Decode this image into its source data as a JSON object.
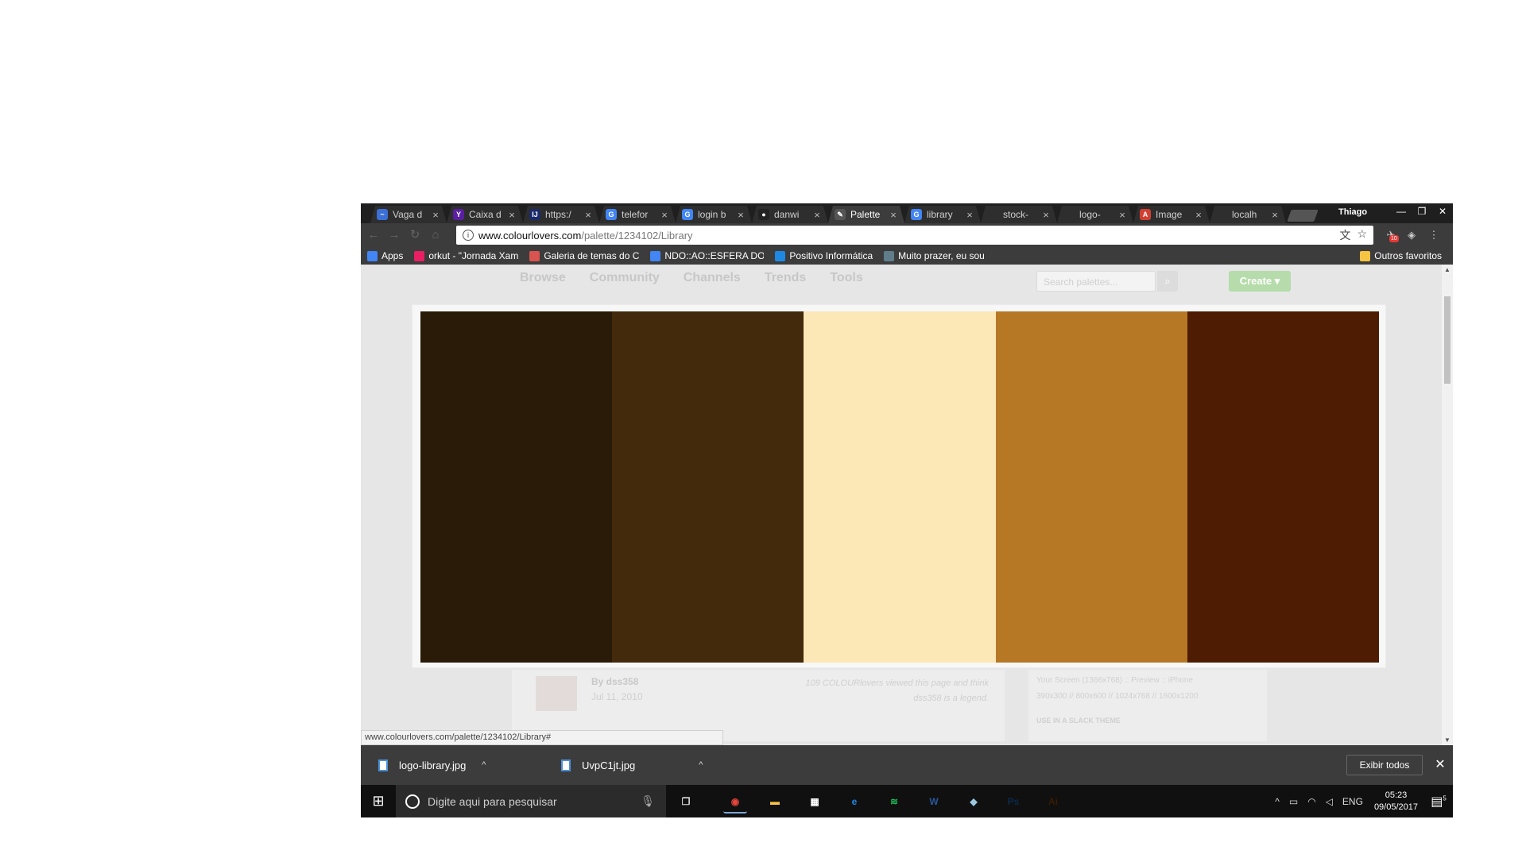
{
  "browser": {
    "tabs": [
      {
        "label": "Vaga d",
        "favicon_color": "#3b6fd6",
        "favicon_glyph": "~",
        "icon": "vaga-favicon-icon"
      },
      {
        "label": "Caixa d",
        "favicon_color": "#5a1fa0",
        "favicon_glyph": "Y",
        "icon": "yahoo-mail-icon"
      },
      {
        "label": "https:/",
        "favicon_color": "#1b2a6b",
        "favicon_glyph": "IJ",
        "icon": "intellij-icon"
      },
      {
        "label": "telefor",
        "favicon_color": "#4285f4",
        "favicon_glyph": "G",
        "icon": "google-icon"
      },
      {
        "label": "login b",
        "favicon_color": "#4285f4",
        "favicon_glyph": "G",
        "icon": "google-icon"
      },
      {
        "label": "danwi",
        "favicon_color": "#222222",
        "favicon_glyph": "●",
        "icon": "github-icon"
      },
      {
        "label": "Palette",
        "favicon_color": "#555555",
        "favicon_glyph": "✎",
        "icon": "colourlovers-icon",
        "active": true
      },
      {
        "label": "library",
        "favicon_color": "#4285f4",
        "favicon_glyph": "G",
        "icon": "google-icon"
      },
      {
        "label": "stock-",
        "favicon_color": "#2e2e2e",
        "favicon_glyph": "",
        "icon": "blank-page-icon"
      },
      {
        "label": "logo-",
        "favicon_color": "#2e2e2e",
        "favicon_glyph": "",
        "icon": "blank-page-icon"
      },
      {
        "label": "Image",
        "favicon_color": "#d23f31",
        "favicon_glyph": "A",
        "icon": "angular-icon"
      },
      {
        "label": "localh",
        "favicon_color": "#2e2e2e",
        "favicon_glyph": "",
        "icon": "blank-page-icon"
      }
    ],
    "profile_name": "Thiago",
    "window_controls": {
      "minimize": "—",
      "restore": "❐",
      "close": "✕"
    },
    "address": {
      "host": "www.colourlovers.com",
      "path": "/palette/1234102/Library"
    },
    "extension_badge": "10",
    "bookmarks": [
      {
        "label": "Apps",
        "color": "#4285f4"
      },
      {
        "label": "orkut - \"Jornada Xam",
        "color": "#e91e63"
      },
      {
        "label": "Galeria de temas do C",
        "color": "#d9534f"
      },
      {
        "label": "NDO::AO::ESFERA DO",
        "color": "#4285f4"
      },
      {
        "label": "Positivo Informática",
        "color": "#1e88e5"
      },
      {
        "label": "Muito prazer, eu sou",
        "color": "#607d8b"
      }
    ],
    "other_bookmarks": "Outros favoritos",
    "status_url": "www.colourlovers.com/palette/1234102/Library#"
  },
  "site": {
    "nav": [
      "Browse",
      "Community",
      "Channels",
      "Trends",
      "Tools"
    ],
    "search_placeholder": "Search palettes...",
    "create_label": "Create ▾",
    "palette": {
      "colors": [
        "#2a1a08",
        "#432a0c",
        "#fce7b6",
        "#b77826",
        "#4d1c02"
      ]
    },
    "author_line": "By dss358",
    "date": "Jul 11, 2010",
    "viewed_text": "109 COLOURlovers viewed this page and think dss358 is a legend.",
    "screen_line": "Your Screen (1366x768) :: Preview :: iPhone",
    "sizes_line": "390x300 // 800x600 // 1024x768 // 1600x1200",
    "slack_line": "USE IN A SLACK THEME"
  },
  "downloads": {
    "items": [
      "logo-library.jpg",
      "UvpC1jt.jpg"
    ],
    "show_all": "Exibir todos"
  },
  "taskbar": {
    "search_placeholder": "Digite aqui para pesquisar",
    "apps": [
      {
        "name": "chrome-icon",
        "glyph": "◉",
        "color": "#e8453c"
      },
      {
        "name": "file-explorer-icon",
        "glyph": "▬",
        "color": "#f6c342"
      },
      {
        "name": "store-icon",
        "glyph": "▦",
        "color": "#ffffff"
      },
      {
        "name": "edge-icon",
        "glyph": "e",
        "color": "#1e88e5"
      },
      {
        "name": "spotify-icon",
        "glyph": "≋",
        "color": "#1db954"
      },
      {
        "name": "word-icon",
        "glyph": "W",
        "color": "#2b579a"
      },
      {
        "name": "paper-plane-app-icon",
        "glyph": "◆",
        "color": "#9cc8e0"
      },
      {
        "name": "photoshop-icon",
        "glyph": "Ps",
        "color": "#0b2a4a"
      },
      {
        "name": "illustrator-icon",
        "glyph": "Ai",
        "color": "#3a1a00"
      }
    ],
    "language": "ENG",
    "time": "05:23",
    "date": "09/05/2017",
    "notifications": "5"
  }
}
